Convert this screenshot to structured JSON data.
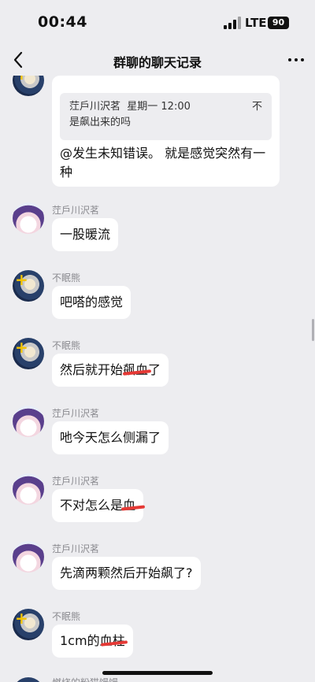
{
  "status": {
    "time": "00:44",
    "network": "LTE",
    "battery": "90"
  },
  "nav": {
    "title": "群聊的聊天记录"
  },
  "messages": [
    {
      "type": "quote",
      "sender": "",
      "avatar": "b",
      "quote": {
        "author": "茳戶川沢茗",
        "time": "星期一 12:00",
        "extra": "不",
        "text": "是飙出来的吗"
      },
      "text": "@发生未知错误。 就是感觉突然有一种"
    },
    {
      "sender": "茳戶川沢茗",
      "avatar": "a",
      "text": "一股暖流"
    },
    {
      "sender": "不眠熊",
      "avatar": "b",
      "text": "吧嗒的感觉"
    },
    {
      "sender": "不眠熊",
      "avatar": "b",
      "text": "然后就开始飙血了"
    },
    {
      "sender": "茳戶川沢茗",
      "avatar": "a",
      "text": "吔今天怎么侧漏了"
    },
    {
      "sender": "茳戶川沢茗",
      "avatar": "a",
      "text": "不对怎么是血"
    },
    {
      "sender": "茳戶川沢茗",
      "avatar": "a",
      "text": "先滴两颗然后开始飙了?"
    },
    {
      "sender": "不眠熊",
      "avatar": "b",
      "text": "1cm的血柱"
    },
    {
      "sender": "燃烧的粉猫馒馒",
      "avatar": "b",
      "text": ""
    }
  ]
}
